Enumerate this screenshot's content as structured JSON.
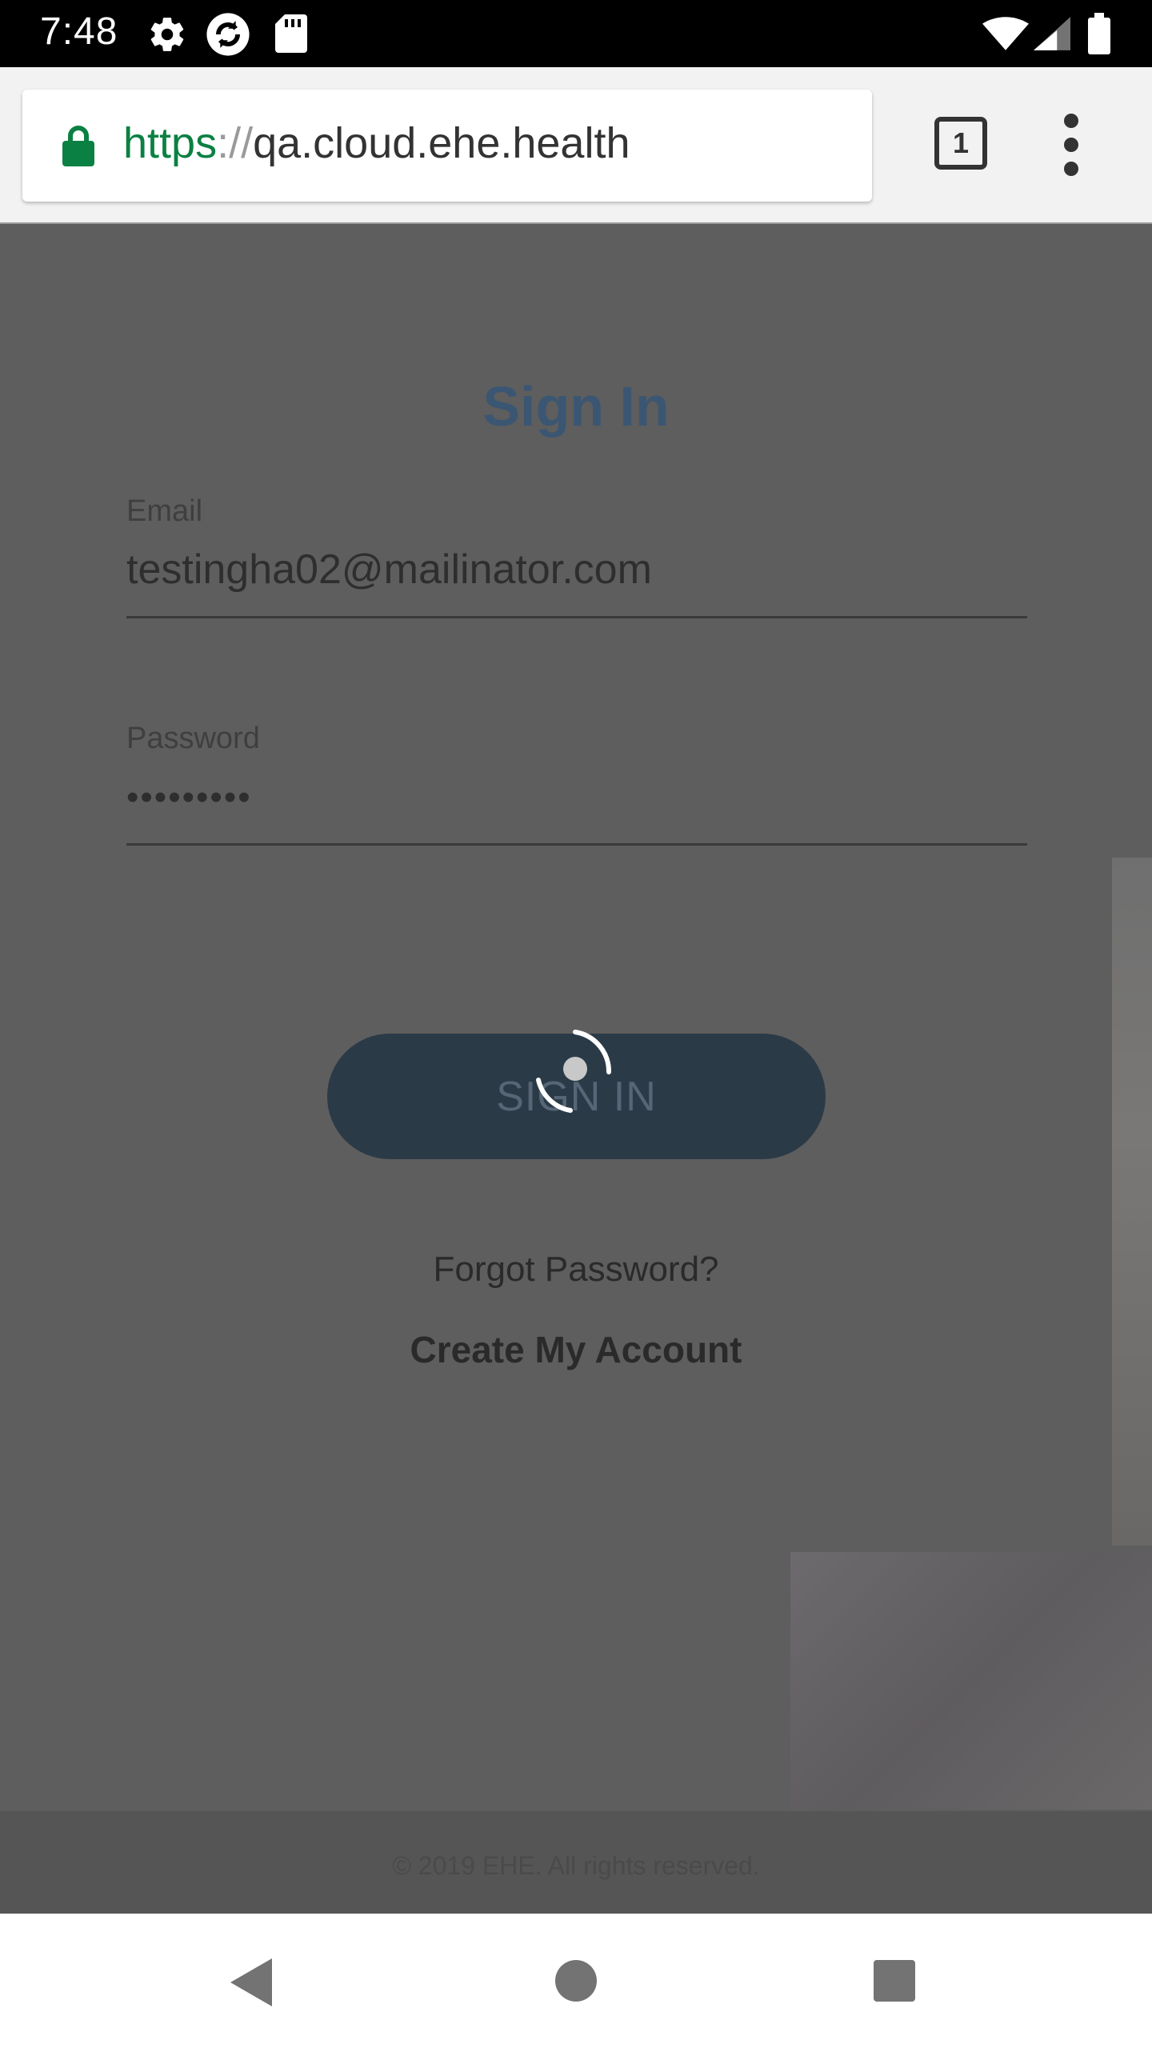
{
  "status_bar": {
    "time": "7:48",
    "icons": [
      "gear-icon",
      "sync-icon",
      "sd-card-icon",
      "wifi-icon",
      "signal-icon",
      "battery-icon"
    ]
  },
  "browser": {
    "url_scheme": "https",
    "url_separator": "://",
    "url_host": "qa.cloud.ehe.health",
    "tab_count": "1",
    "lock_color": "#0b8043"
  },
  "sign_in": {
    "title": "Sign In",
    "email_label": "Email",
    "email_value": "testingha02@mailinator.com",
    "password_label": "Password",
    "password_value": "•••••••••",
    "button_label": "SIGN IN",
    "forgot_password": "Forgot Password?",
    "create_account": "Create My Account"
  },
  "footer": {
    "copyright": "© 2019 EHE. All rights reserved."
  },
  "colors": {
    "title": "#3b5672",
    "button_bg": "#2b3a47",
    "overlay": "#5e5e5e"
  }
}
